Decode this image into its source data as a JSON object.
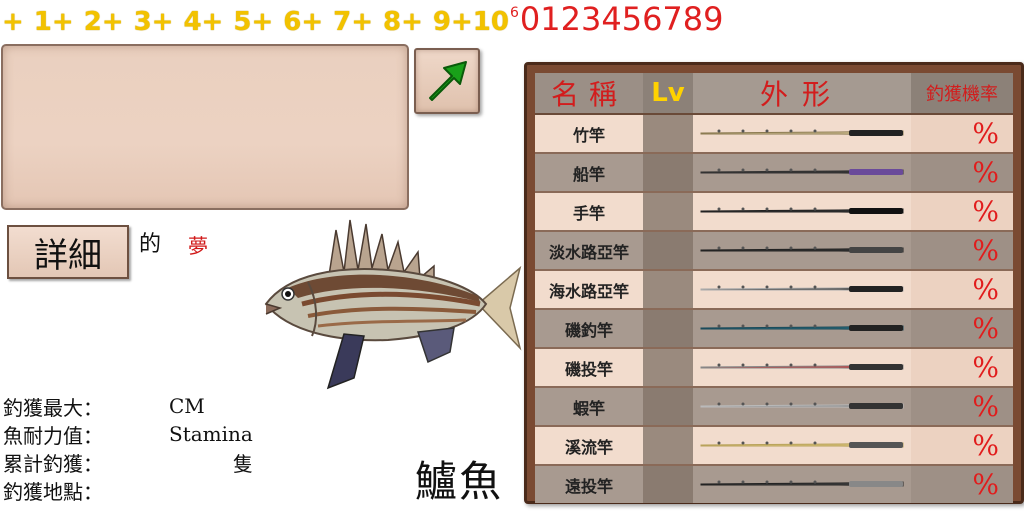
{
  "level_strip": {
    "levels": [
      "+",
      "1+",
      "2+",
      "3+",
      "4+",
      "5+",
      "6+",
      "7+",
      "8+",
      "9+10"
    ],
    "superscript": "6",
    "digits": "0123456789"
  },
  "detail_button": {
    "label": "詳細"
  },
  "possessive": "的",
  "dream": "夢",
  "stats": {
    "max_catch_label": "釣獲最大：",
    "max_catch_unit": "CM",
    "stamina_label": "魚耐力值：",
    "stamina_value": "Stamina",
    "total_label": "累計釣獲：",
    "total_unit": "隻",
    "location_label": "釣獲地點："
  },
  "fish_name": "鱸魚",
  "rod_table": {
    "headers": {
      "name": "名稱",
      "lv": "Lv",
      "shape": "外形",
      "rate": "釣獲機率"
    },
    "rows": [
      {
        "name": "竹竿",
        "rate": "%",
        "rod_style": "bamboo"
      },
      {
        "name": "船竿",
        "rate": "%",
        "rod_style": "boat"
      },
      {
        "name": "手竿",
        "rate": "%",
        "rod_style": "hand"
      },
      {
        "name": "淡水路亞竿",
        "rate": "%",
        "rod_style": "fresh-lure"
      },
      {
        "name": "海水路亞竿",
        "rate": "%",
        "rod_style": "sea-lure"
      },
      {
        "name": "磯釣竿",
        "rate": "%",
        "rod_style": "rock"
      },
      {
        "name": "磯投竿",
        "rate": "%",
        "rod_style": "rock-cast"
      },
      {
        "name": "蝦竿",
        "rate": "%",
        "rod_style": "shrimp"
      },
      {
        "name": "溪流竿",
        "rate": "%",
        "rod_style": "stream"
      },
      {
        "name": "遠投竿",
        "rate": "%",
        "rod_style": "surf"
      }
    ]
  },
  "colors": {
    "level_yellow": "#f2c200",
    "accent_red": "#e02020",
    "board_brown": "#7a4a32",
    "parchment": "#ecd2c2"
  },
  "icons": {
    "arrow_button": "green-arrow-icon",
    "fish": "sea-bass-illustration"
  }
}
